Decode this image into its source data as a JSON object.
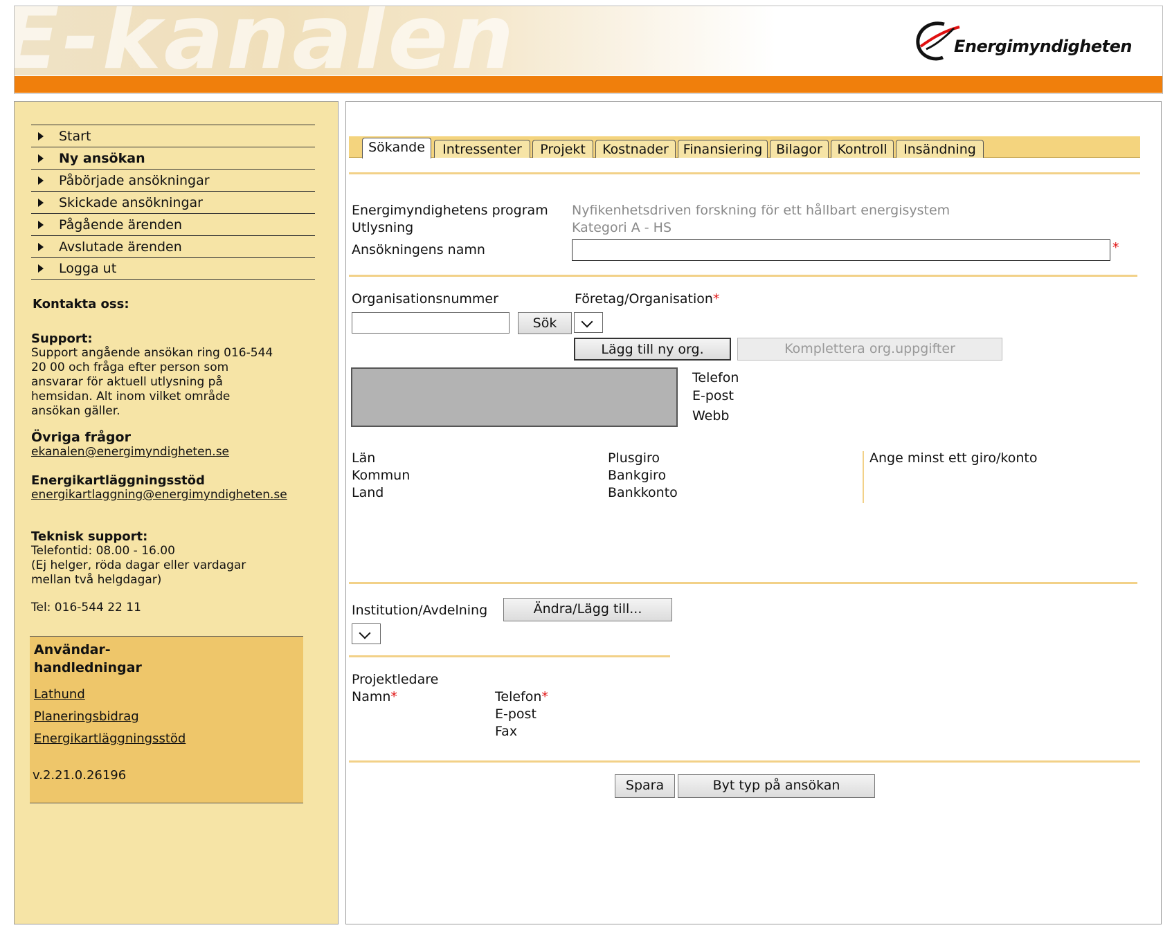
{
  "header": {
    "logo_text": "E-kanalen",
    "brand_name": "Energimyndigheten",
    "brand_color": "#f07f0c"
  },
  "sidebar": {
    "nav": [
      {
        "label": "Start",
        "bold": false
      },
      {
        "label": "Ny ansökan",
        "bold": true
      },
      {
        "label": "Påbörjade ansökningar",
        "bold": false
      },
      {
        "label": "Skickade ansökningar",
        "bold": false
      },
      {
        "label": "Pågående ärenden",
        "bold": false
      },
      {
        "label": "Avslutade ärenden",
        "bold": false
      },
      {
        "label": "Logga ut",
        "bold": false
      }
    ],
    "contact_title": "Kontakta oss:",
    "support_title": "Support:",
    "support_lines": [
      "Support angående ansökan ring 016-544",
      "20 00 och fråga efter person som",
      "ansvarar för aktuell utlysning på",
      "hemsidan. Alt inom vilket område",
      "ansökan gäller."
    ],
    "other_title": "Övriga frågor",
    "other_email": "ekanalen@energimyndigheten.se",
    "audit_title": "Energikartläggningsstöd",
    "audit_email": "energikartlaggning@energimyndigheten.se",
    "tech_title": "Teknisk support:",
    "tech_lines": [
      "Telefontid: 08.00 - 16.00",
      "(Ej helger, röda dagar eller vardagar",
      "mellan två helgdagar)"
    ],
    "tech_phone": "Tel: 016-544 22 11",
    "manuals_title_1": "Användar-",
    "manuals_title_2": "handledningar",
    "manuals": [
      "Lathund",
      "Planeringsbidrag",
      "Energikartläggningsstöd"
    ],
    "version": "v.2.21.0.26196"
  },
  "main": {
    "tabs": [
      "Sökande",
      "Intressenter",
      "Projekt",
      "Kostnader",
      "Finansiering",
      "Bilagor",
      "Kontroll",
      "Insändning"
    ],
    "active_tab": 0,
    "program_label": "Energimyndighetens program",
    "program_value": "Nyfikenhetsdriven forskning för ett hållbart energisystem",
    "call_label": "Utlysning",
    "call_value": "Kategori A - HS",
    "app_name_label": "Ansökningens namn",
    "app_name_value": "",
    "org_number_label": "Organisationsnummer",
    "org_number_value": "",
    "search_button": "Sök",
    "company_label": "Företag/Organisation",
    "add_org_button": "Lägg till ny org.",
    "complete_org_button": "Komplettera org.uppgifter",
    "phone_label": "Telefon",
    "email_label": "E-post",
    "web_label": "Webb",
    "county_label": "Län",
    "municipality_label": "Kommun",
    "country_label": "Land",
    "plusgiro_label": "Plusgiro",
    "bankgiro_label": "Bankgiro",
    "bank_account_label": "Bankkonto",
    "giro_hint": "Ange minst ett giro/konto",
    "institution_label": "Institution/Avdelning",
    "change_add_button": "Ändra/Lägg till...",
    "project_leader_label": "Projektledare",
    "name_label": "Namn",
    "pl_phone_label": "Telefon",
    "pl_email_label": "E-post",
    "pl_fax_label": "Fax",
    "save_button": "Spara",
    "change_type_button": "Byt typ på ansökan",
    "required_mark": "*"
  }
}
